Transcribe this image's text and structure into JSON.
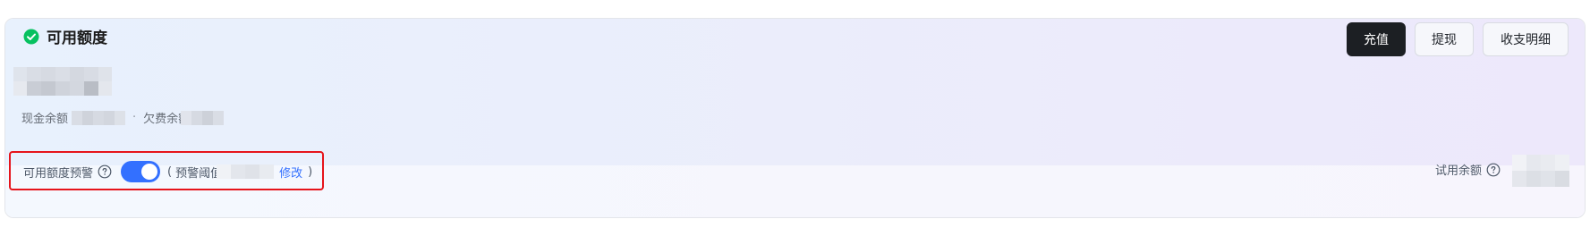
{
  "card": {
    "title": "可用额度",
    "title_icon": "check-circle-icon",
    "accent_color": "#07c160"
  },
  "balance": {
    "cash_label": "现金余额",
    "separator": "·",
    "arrears_label": "欠费余额"
  },
  "actions": {
    "recharge_label": "充值",
    "withdraw_label": "提现",
    "details_label": "收支明细"
  },
  "alert": {
    "label": "可用额度预警",
    "enabled": true,
    "open_paren": "(",
    "threshold_label": "预警阈值",
    "edit_label": "修改",
    "close_paren": ")",
    "toggle_color": "#3370ff",
    "highlight_color": "#e6141b"
  },
  "trial": {
    "label": "试用余额"
  }
}
